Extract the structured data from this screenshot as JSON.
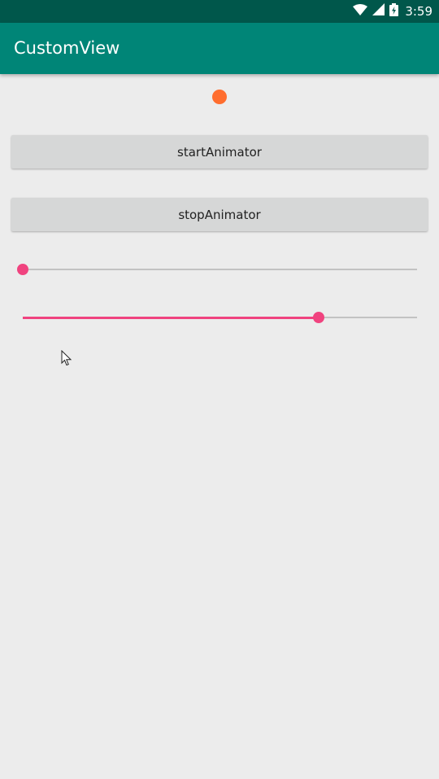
{
  "status_bar": {
    "time": "3:59",
    "icons": [
      "wifi-icon",
      "signal-icon",
      "battery-charging-icon"
    ]
  },
  "app_bar": {
    "title": "CustomView"
  },
  "buttons": {
    "start_label": "startAnimator",
    "stop_label": "stopAnimator"
  },
  "sliders": [
    {
      "name": "seekbar-1",
      "progress": 0.0
    },
    {
      "name": "seekbar-2",
      "progress": 0.75
    }
  ],
  "colors": {
    "status_bar": "#00574b",
    "app_bar": "#008577",
    "accent": "#f0437f",
    "dot": "#ff6d2e",
    "background": "#ececec",
    "button": "#d6d7d7",
    "track": "#c2c2c2"
  }
}
